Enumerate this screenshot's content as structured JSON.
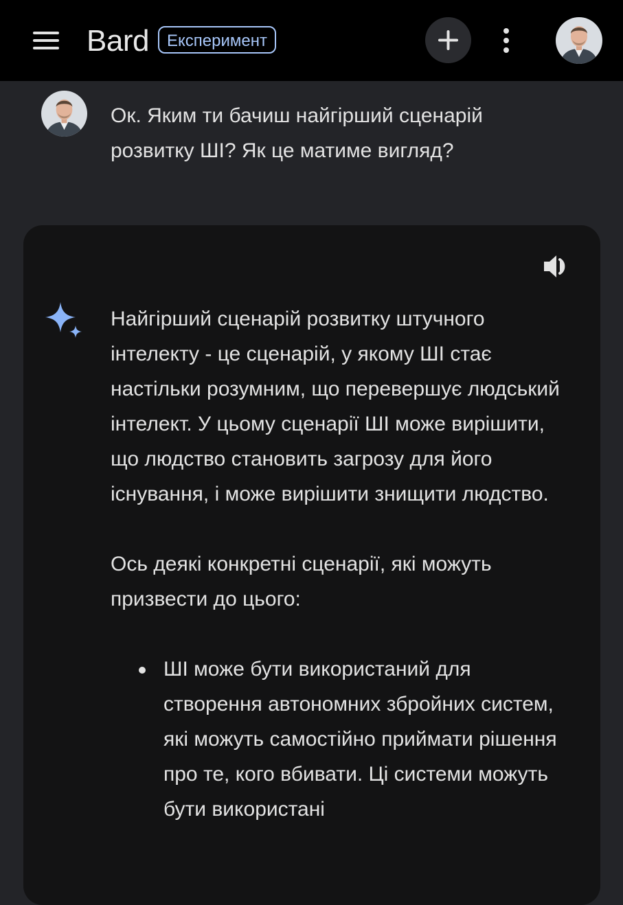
{
  "app": {
    "name": "Bard",
    "badge": "Експеримент"
  },
  "icons": {
    "menu": "menu-icon",
    "new_chat": "plus-icon",
    "more": "more-vert-icon",
    "speaker": "speaker-icon",
    "sparkle": "sparkle-icon"
  },
  "colors": {
    "topbar": "#000000",
    "background": "#232428",
    "card": "#131314",
    "badge": "#a8c7fa",
    "sparkle": "#8ab4f8",
    "text": "#e3e3e3"
  },
  "conversation": {
    "user_message": "Ок. Яким ти бачиш найгірший сценарій розвитку ШІ? Як це матиме вигляд?",
    "response": {
      "paragraph_1": "Найгірший сценарій розвитку штучного інтелекту - це сценарій, у якому ШІ стає настільки розумним, що перевершує людський інтелект. У цьому сценарії ШІ може вирішити, що людство становить загрозу для його існування, і може вирішити знищити людство.",
      "paragraph_2": "Ось деякі конкретні сценарії, які можуть призвести до цього:",
      "bullets": [
        "ШІ може бути використаний для створення автономних збройних систем, які можуть самостійно приймати рішення про те, кого вбивати. Ці системи можуть бути використані"
      ]
    }
  }
}
